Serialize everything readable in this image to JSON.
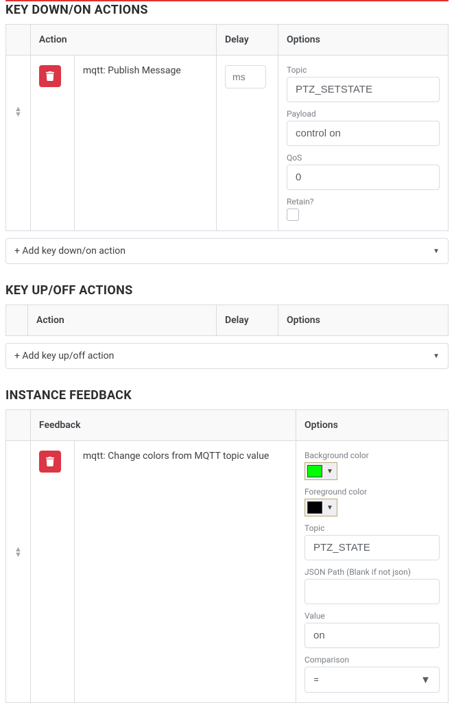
{
  "sections": {
    "key_down": {
      "title": "KEY DOWN/ON ACTIONS",
      "headers": {
        "action": "Action",
        "delay": "Delay",
        "options": "Options"
      },
      "rows": [
        {
          "action": "mqtt: Publish Message",
          "delay_placeholder": "ms",
          "topic_label": "Topic",
          "topic": "PTZ_SETSTATE",
          "payload_label": "Payload",
          "payload": "control on",
          "qos_label": "QoS",
          "qos": "0",
          "retain_label": "Retain?"
        }
      ],
      "add_label": "+ Add key down/on action"
    },
    "key_up": {
      "title": "KEY UP/OFF ACTIONS",
      "headers": {
        "action": "Action",
        "delay": "Delay",
        "options": "Options"
      },
      "add_label": "+ Add key up/off action"
    },
    "feedback": {
      "title": "INSTANCE FEEDBACK",
      "headers": {
        "feedback": "Feedback",
        "options": "Options"
      },
      "rows": [
        {
          "feedback": "mqtt: Change colors from MQTT topic value",
          "bg_label": "Background color",
          "bg_color": "#00ff00",
          "fg_label": "Foreground color",
          "fg_color": "#000000",
          "topic_label": "Topic",
          "topic": "PTZ_STATE",
          "jsonpath_label": "JSON Path (Blank if not json)",
          "jsonpath": "",
          "value_label": "Value",
          "value": "on",
          "comparison_label": "Comparison",
          "comparison": "="
        }
      ]
    }
  }
}
